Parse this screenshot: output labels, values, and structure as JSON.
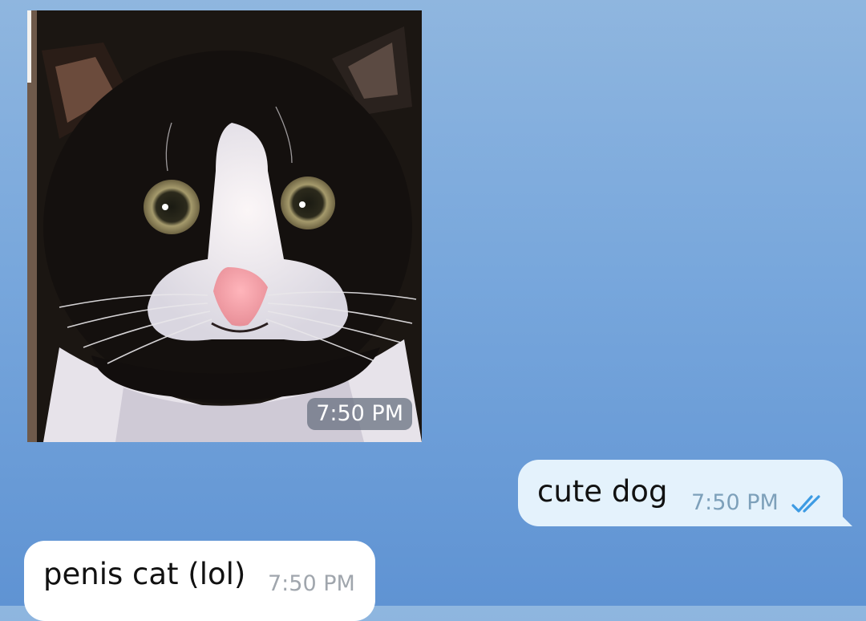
{
  "messages": [
    {
      "type": "photo",
      "direction": "incoming",
      "image_description_name": "tuxedo-cat-photo",
      "time": "7:50 PM"
    },
    {
      "type": "text",
      "direction": "outgoing",
      "text": "cute dog",
      "time": "7:50 PM",
      "status_icon": "double-check-icon"
    },
    {
      "type": "text",
      "direction": "incoming",
      "text": "penis cat (lol)",
      "time": "7:50 PM"
    }
  ],
  "colors": {
    "background_top": "#8fb6df",
    "background_bottom": "#5f93d3",
    "outgoing_bubble": "#e4f2fc",
    "incoming_bubble": "#ffffff",
    "read_check": "#3d9be3"
  }
}
